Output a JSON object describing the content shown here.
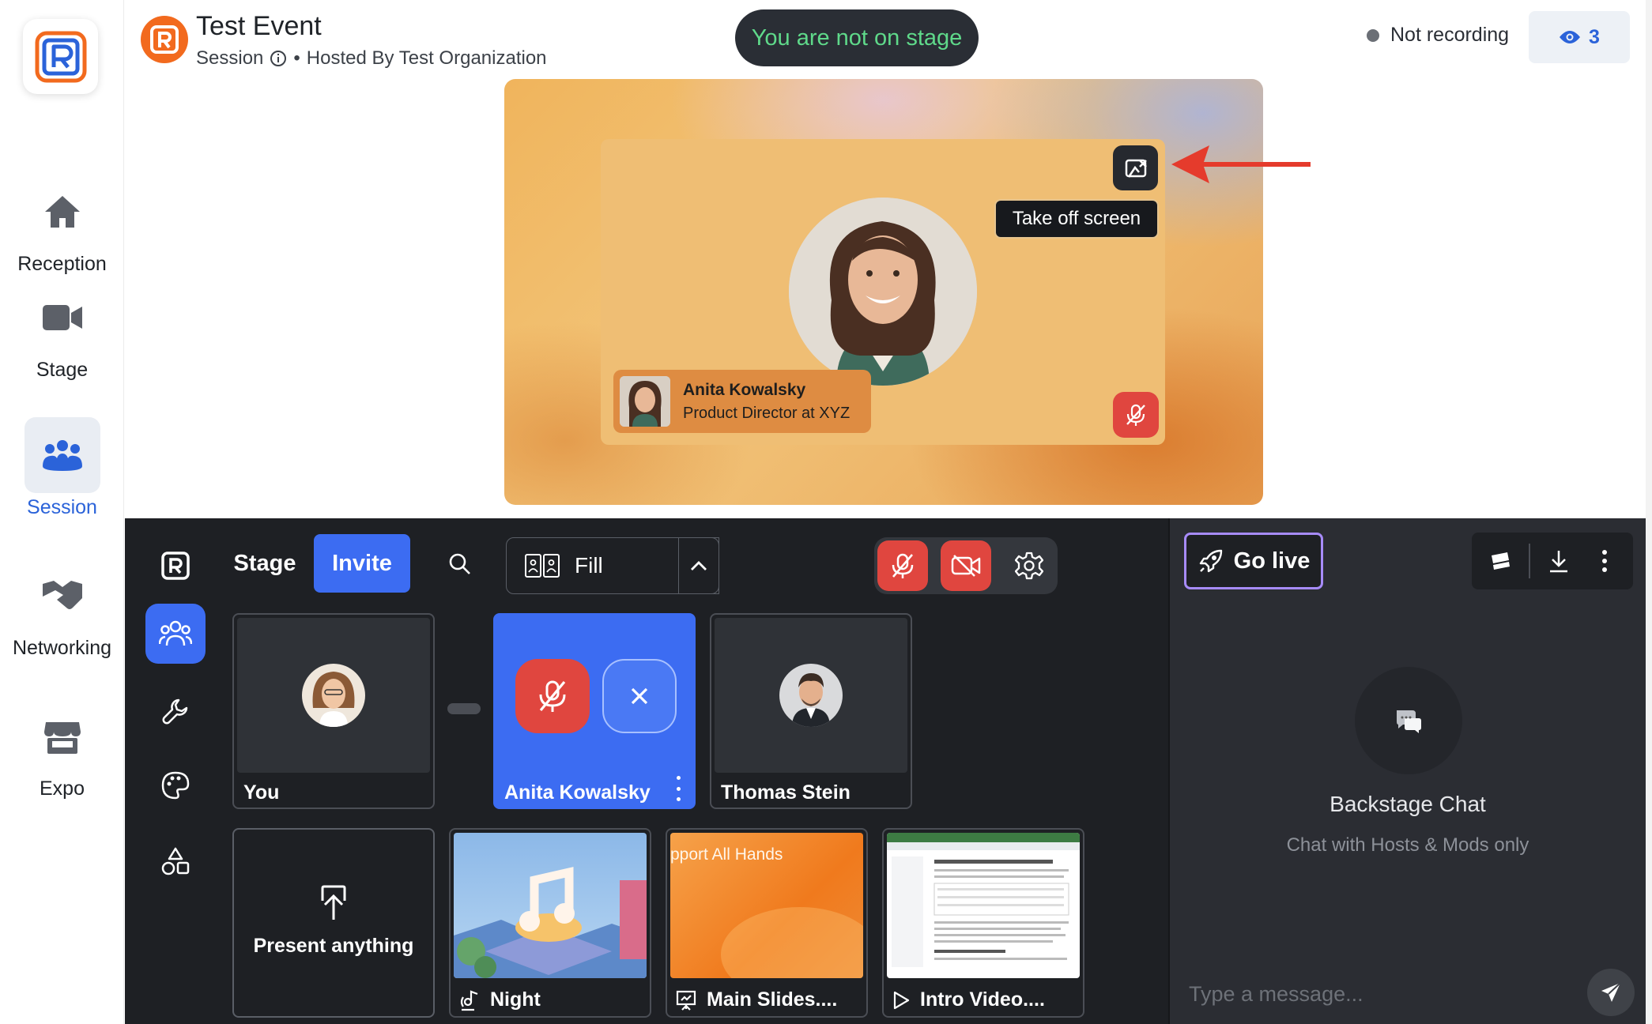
{
  "nav": {
    "items": [
      {
        "label": "Reception",
        "icon": "home-icon"
      },
      {
        "label": "Stage",
        "icon": "video-camera-icon"
      },
      {
        "label": "Session",
        "icon": "people-icon",
        "active": true
      },
      {
        "label": "Networking",
        "icon": "handshake-icon"
      },
      {
        "label": "Expo",
        "icon": "storefront-icon"
      }
    ]
  },
  "header": {
    "title": "Test Event",
    "type": "Session",
    "separator": "•",
    "host": "Hosted By Test Organization",
    "stage_status": "You are not on stage",
    "recording_status": "Not recording",
    "viewer_count": "3"
  },
  "stage_preview": {
    "tooltip": "Take off screen",
    "speaker_name": "Anita Kowalsky",
    "speaker_title": "Product Director at XYZ"
  },
  "studio": {
    "tabs": {
      "stage": "Stage",
      "invite": "Invite"
    },
    "layout": "Fill",
    "participants": [
      {
        "name": "You"
      },
      {
        "name": "Anita Kowalsky"
      },
      {
        "name": "Thomas Stein"
      }
    ],
    "media": [
      {
        "label": "Present anything"
      },
      {
        "label": "Night"
      },
      {
        "label": "Main Slides...."
      },
      {
        "label": "Intro Video...."
      }
    ],
    "slide_caption": "pport All Hands"
  },
  "chat": {
    "go_live": "Go live",
    "title": "Backstage Chat",
    "subtitle": "Chat with Hosts & Mods only",
    "placeholder": "Type a message..."
  },
  "colors": {
    "accent": "#3c6cf2",
    "danger": "#e0463f",
    "stage_pill_text": "#5fd98a",
    "brand_orange": "#f26a1e",
    "go_live_border": "#a78bfa"
  }
}
